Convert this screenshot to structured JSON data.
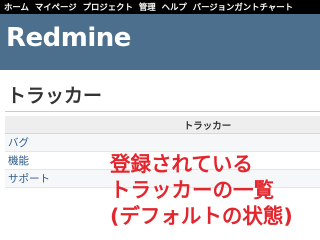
{
  "top_menu": {
    "items": [
      "ホーム",
      "マイページ",
      "プロジェクト",
      "管理",
      "ヘルプ",
      "バージョンガントチャート"
    ]
  },
  "header": {
    "app_title": "Redmine",
    "background_color": "#4b6f8c"
  },
  "main": {
    "page_title": "トラッカー",
    "table": {
      "column_header": "トラッカー",
      "rows": [
        "バグ",
        "機能",
        "サポート"
      ]
    }
  },
  "caption": {
    "lines": [
      "登録されている",
      "トラッカーの一覧",
      "(デフォルトの状態)"
    ],
    "color": "#e3262d"
  }
}
